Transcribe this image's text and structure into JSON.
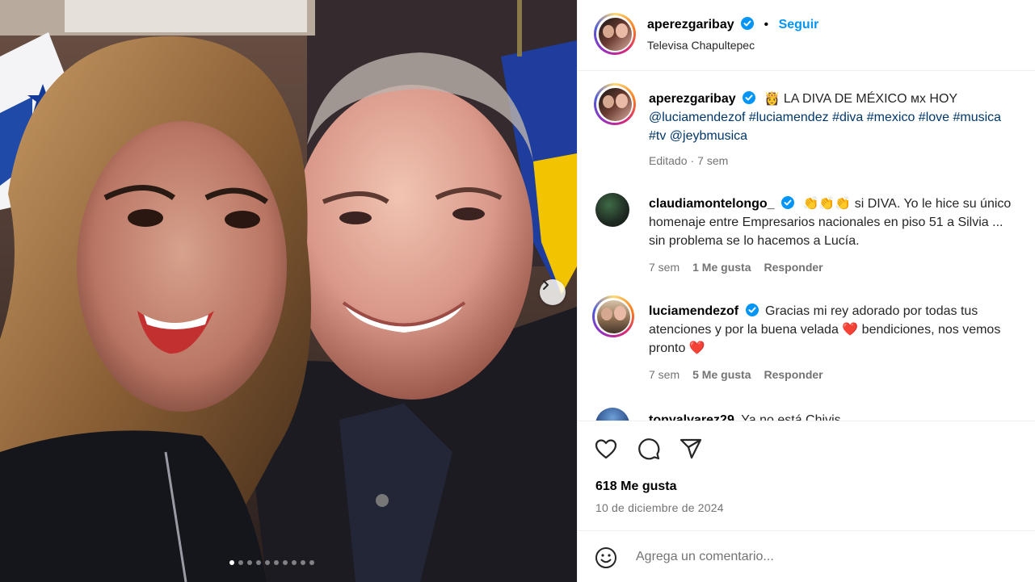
{
  "post": {
    "photo_alt": "Selfie of two smiling people",
    "carousel_count": 10,
    "carousel_active": 0
  },
  "header": {
    "username": "aperezgaribay",
    "separator": "•",
    "follow_label": "Seguir",
    "location": "Televisa Chapultepec"
  },
  "caption": {
    "username": "aperezgaribay",
    "emoji": "👸",
    "text_lead": "LA DIVA DE MÉXICO ᴍx HOY",
    "line2": [
      "@luciamendezof",
      "#luciamendez",
      "#diva",
      "#mexico",
      "#love",
      "#musica"
    ],
    "line3": [
      "#tv",
      "@jeybmusica"
    ],
    "edited": "Editado",
    "dot": "·",
    "time": "7 sem"
  },
  "comments": [
    {
      "username": "claudiamontelongo_",
      "line1_text": "👏👏👏 si DIVA. Yo le hice su único",
      "line2": "homenaje entre Empresarios nacionales en piso 51 a Silvia ...",
      "line3": "sin problema se lo hacemos a Lucía.",
      "time": "7 sem",
      "likes": "1 Me gusta",
      "reply": "Responder"
    },
    {
      "username": "luciamendezof",
      "line1_text": "Gracias mi rey adorado por todas tus",
      "line2_pre": "atenciones y por la buena velada",
      "line2_heart": "❤️",
      "line2_post": "bendiciones, nos vemos",
      "line3_pre": "pronto",
      "line3_heart": "❤️",
      "time": "7 sem",
      "likes": "5 Me gusta",
      "reply": "Responder"
    },
    {
      "username": "tonyalvarez29",
      "line1_text": "Ya no está Chivis"
    }
  ],
  "actions": {
    "likes": "618 Me gusta",
    "date": "10 de diciembre de 2024"
  },
  "comment_input": {
    "placeholder": "Agrega un comentario..."
  },
  "colors": {
    "link": "#0095f6",
    "hashtag": "#00376b",
    "verified": "#0095f6",
    "muted": "#737373",
    "heart": "#ed1c24"
  },
  "icons": [
    "verified-badge-icon",
    "chevron-right-icon",
    "heart-icon",
    "comment-icon",
    "share-icon",
    "emoji-icon"
  ]
}
